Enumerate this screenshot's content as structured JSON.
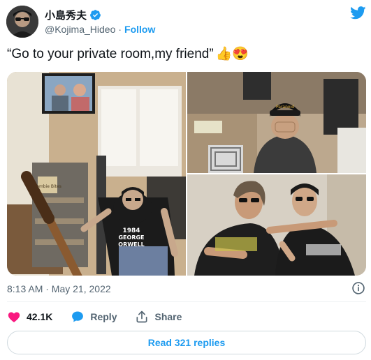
{
  "author": {
    "display_name": "小島秀夫",
    "handle": "@Kojima_Hideo",
    "separator": "·",
    "follow_label": "Follow"
  },
  "tweet": {
    "text": "“Go to your private room,my friend”",
    "emoji": "👍😍"
  },
  "photo_text": {
    "shirt_line1": "1984",
    "shirt_line2": "GEORGE",
    "shirt_line3": "ORWELL",
    "cap_text": "Paranoid",
    "sign_text": "Zombie Bites"
  },
  "meta": {
    "timestamp": "8:13 AM · May 21, 2022"
  },
  "actions": {
    "like_count": "42.1K",
    "reply_label": "Reply",
    "share_label": "Share"
  },
  "footer": {
    "read_replies_label": "Read 321 replies"
  },
  "colors": {
    "accent": "#1d9bf0",
    "like": "#f91880",
    "text": "#0f1419",
    "muted": "#536471"
  }
}
